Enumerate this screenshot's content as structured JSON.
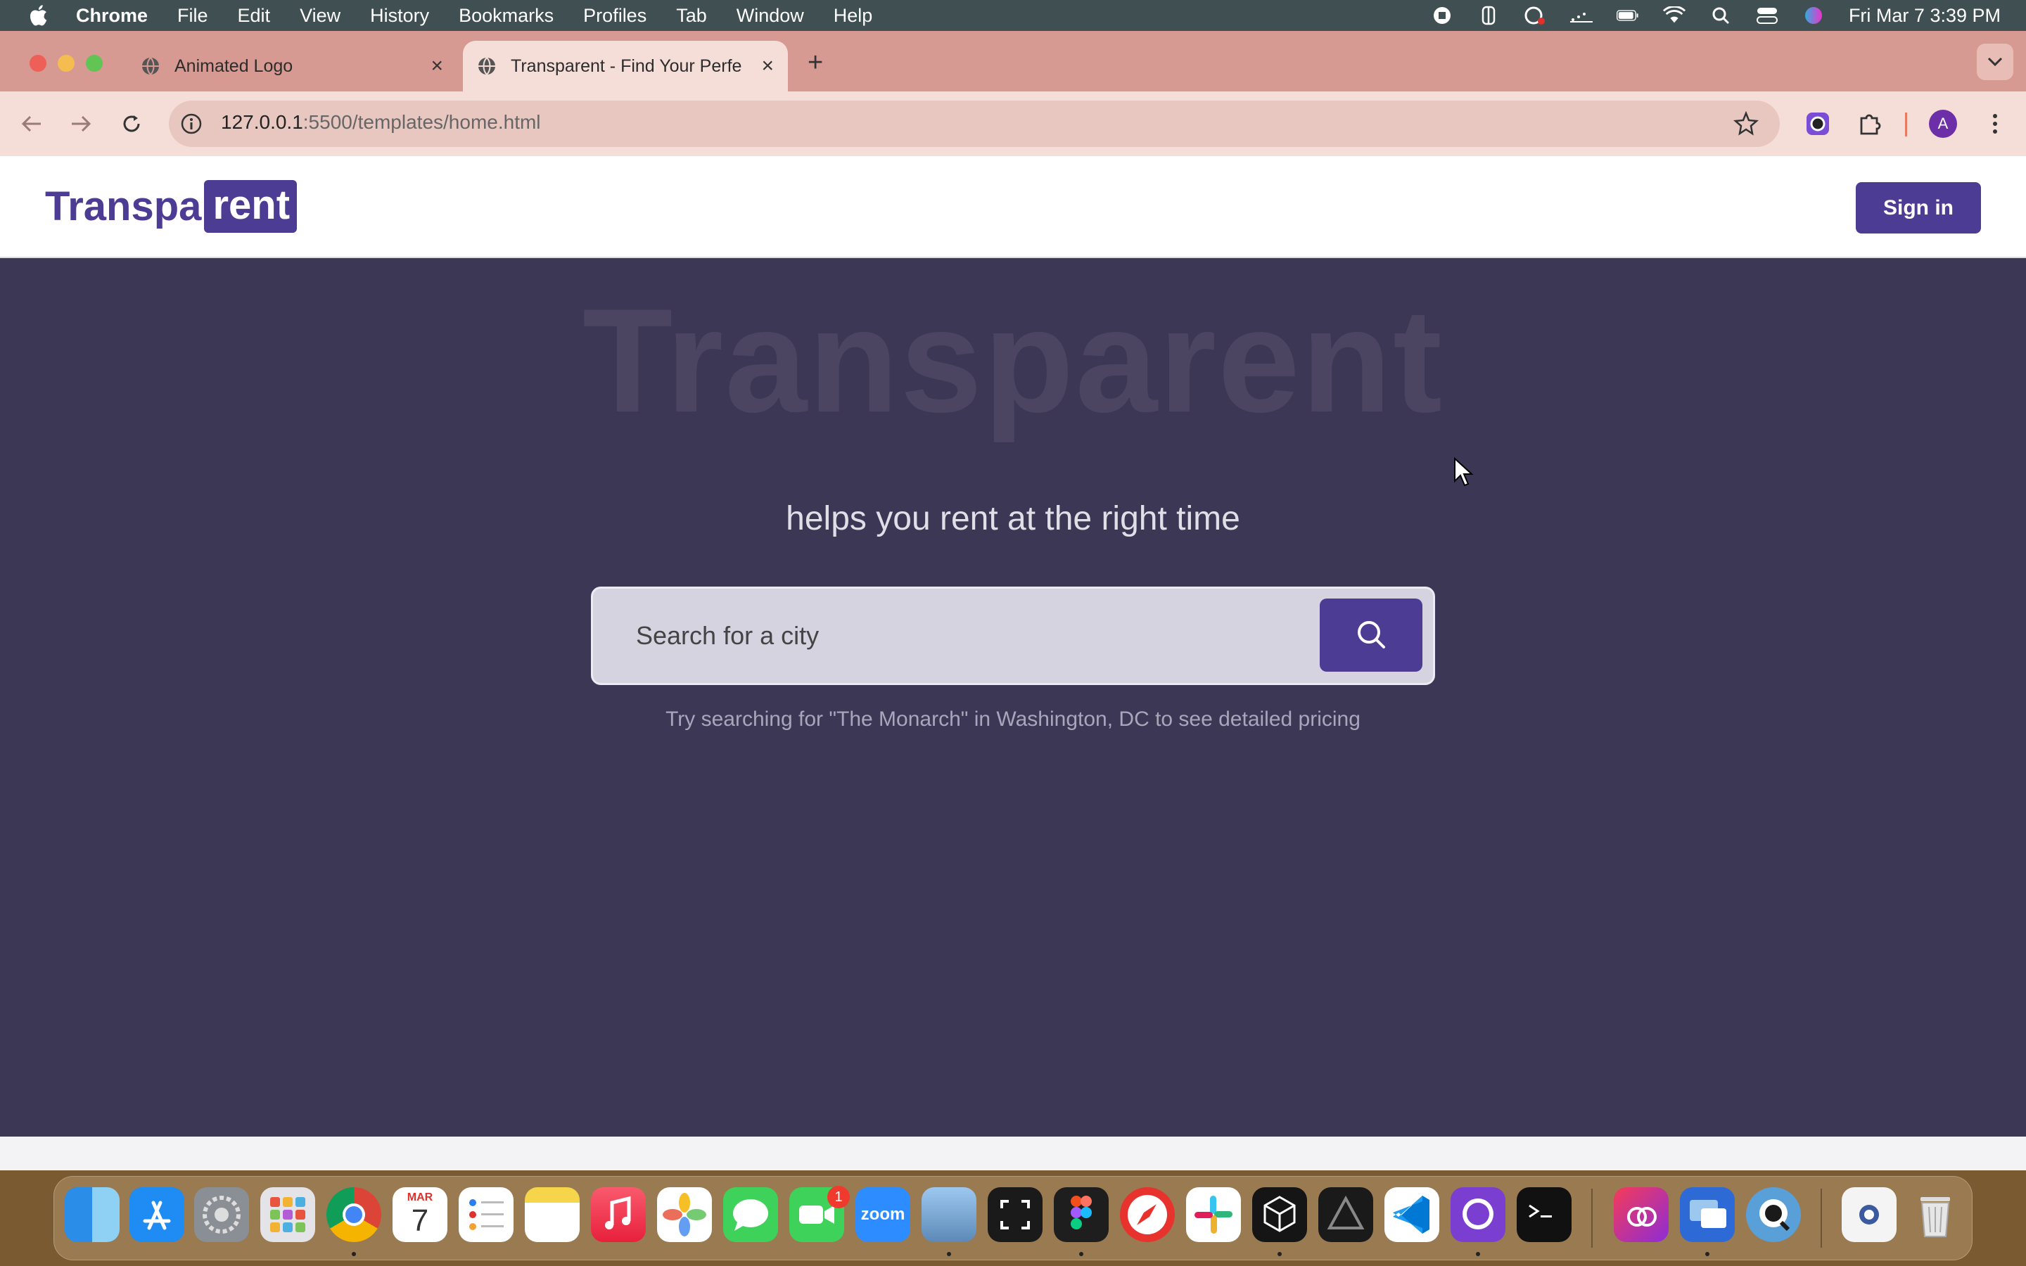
{
  "menubar": {
    "app": "Chrome",
    "items": [
      "File",
      "Edit",
      "View",
      "History",
      "Bookmarks",
      "Profiles",
      "Tab",
      "Window",
      "Help"
    ],
    "clock": "Fri Mar 7  3:39 PM"
  },
  "browser": {
    "tabs": [
      {
        "title": "Animated Logo",
        "active": false
      },
      {
        "title": "Transparent - Find Your Perfe",
        "active": true
      }
    ],
    "url_host": "127.0.0.1",
    "url_path": ":5500/templates/home.html",
    "profile_initial": "A"
  },
  "site": {
    "logo_part1": "Transpa",
    "logo_part2": "rent",
    "signin_label": "Sign in",
    "hero_watermark": "Transparent",
    "tagline": "helps you rent at the right time",
    "search_placeholder": "Search for a city",
    "hint": "Try searching for \"The Monarch\" in Washington, DC to see detailed pricing"
  },
  "dock": {
    "calendar_month": "MAR",
    "calendar_day": "7",
    "facetime_badge": "1",
    "zoom_label": "zoom"
  },
  "colors": {
    "brand": "#4c3c94",
    "hero_bg": "#3c3754",
    "tabstrip": "#d69a92"
  }
}
